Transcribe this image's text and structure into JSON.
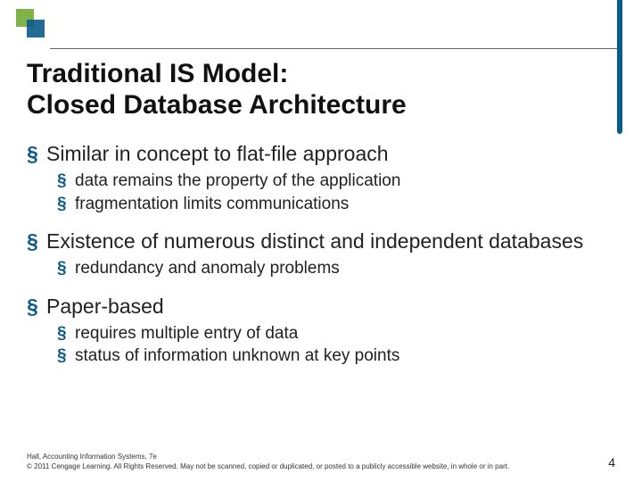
{
  "title_line1": "Traditional IS Model:",
  "title_line2": "Closed Database Architecture",
  "bullets": {
    "b1": "Similar in concept to flat-file approach",
    "b1_1": "data remains the property of the application",
    "b1_2": "fragmentation limits communications",
    "b2": "Existence of numerous distinct and independent databases",
    "b2_1": "redundancy and anomaly problems",
    "b3": "Paper-based",
    "b3_1": "requires multiple entry of data",
    "b3_2": "status of information unknown at key points"
  },
  "footer": {
    "line1": "Hall, Accounting Information Systems, 7e",
    "line2": "© 2011 Cengage Learning. All Rights Reserved. May not be scanned, copied or duplicated, or posted to a publicly accessible website, in whole or in part."
  },
  "page_number": "4"
}
